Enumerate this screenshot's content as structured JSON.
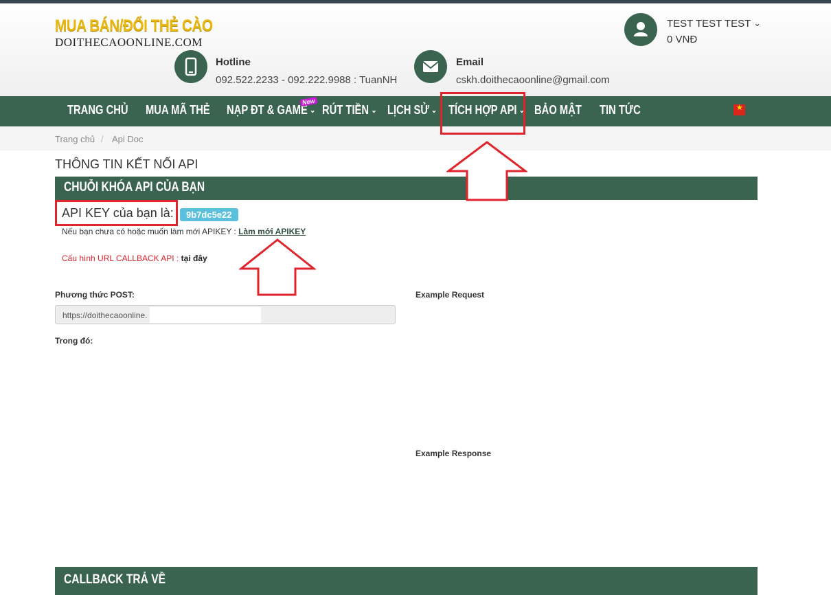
{
  "header": {
    "logo_line1": "MUA BÁN/ĐỔI THẺ CÀO",
    "logo_line2": "DOITHECAOONLINE.COM",
    "hotline_title": "Hotline",
    "hotline_value": "092.522.2233 - 092.222.9988 : TuanNH",
    "email_title": "Email",
    "email_value": "cskh.doithecaoonline@gmail.com",
    "user_name": "TEST TEST TEST",
    "user_balance": "0 VNĐ"
  },
  "nav": {
    "items": [
      {
        "label": "TRANG CHỦ"
      },
      {
        "label": "MUA MÃ THẺ"
      },
      {
        "label": "NẠP ĐT & GAME"
      },
      {
        "label": "RÚT TIỀN"
      },
      {
        "label": "LỊCH SỬ"
      },
      {
        "label": "TÍCH HỢP API"
      },
      {
        "label": "BẢO MẬT"
      },
      {
        "label": "TIN TỨC"
      }
    ],
    "new_badge": "New",
    "caret": "⌄"
  },
  "breadcrumb": {
    "home": "Trang chủ",
    "separator": "/",
    "current": "Api Doc"
  },
  "main": {
    "page_title": "THÔNG TIN KẾT NỐI API",
    "section_api_key": "CHUỖI KHÓA API CỦA BẠN",
    "api_key_label": "API KEY của bạn là:",
    "api_key_value": "9b7dc5e22",
    "refresh_note": "Nếu bạn chưa có hoặc muốn làm mới APIKEY :",
    "refresh_link": "Làm mới APIKEY",
    "callback_note": "Cấu hình URL CALLBACK API :",
    "callback_link": "tại đây",
    "post_label": "Phương thức POST:",
    "post_url": "https://doithecaoonline.",
    "where_label": "Trong đó:",
    "example_request": "Example Request",
    "example_response": "Example Response",
    "section_callback": "CALLBACK TRẢ VỀ"
  },
  "colors": {
    "brand_green": "#3a6350",
    "annotation_red": "#e0242b",
    "key_badge": "#5bc0de"
  }
}
